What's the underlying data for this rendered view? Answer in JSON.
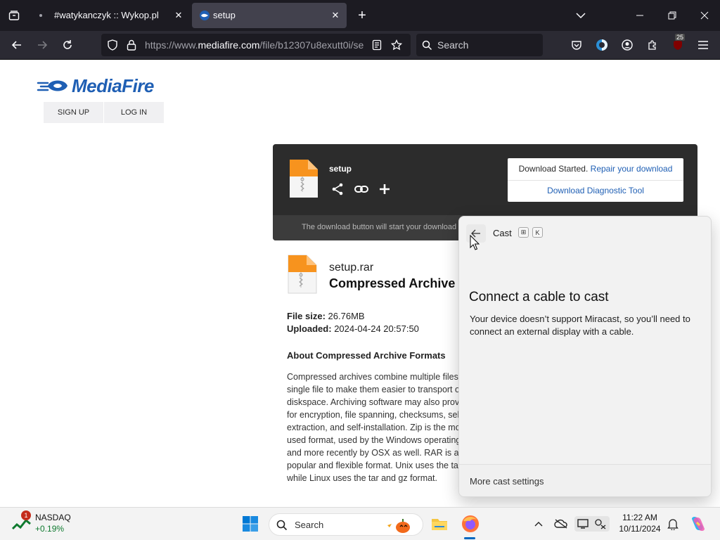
{
  "browser": {
    "tabs": [
      {
        "title": "#watykanczyk :: Wykop.pl",
        "active": false
      },
      {
        "title": "setup",
        "active": true
      }
    ],
    "url": {
      "prefix": "https://www.",
      "domain": "mediafire.com",
      "path": "/file/b12307u8exutt0i/se"
    },
    "search_placeholder": "Search",
    "extension_badge": "25"
  },
  "site": {
    "logo_text": "MediaFire",
    "sign_up": "SIGN UP",
    "log_in": "LOG IN"
  },
  "download": {
    "file_name": "setup",
    "status_prefix": "Download Started.",
    "repair_link": "Repair your download",
    "diagnostic_link": "Download Diagnostic Tool",
    "note": "The download button will start your download"
  },
  "file": {
    "name": "setup.rar",
    "type": "Compressed Archive",
    "size_label": "File size:",
    "size_value": "26.76MB",
    "uploaded_label": "Uploaded:",
    "uploaded_value": "2024-04-24 20:57:50",
    "about_heading": "About Compressed Archive Formats",
    "about_lines": [
      "Compressed archives combine multiple files into a",
      "single file to make them easier to transport or save on",
      "diskspace. Archiving software may also provide options",
      "for encryption, file spanning, checksums, self-",
      "extraction, and self-installation. Zip is the most-",
      "used format, used by the Windows operating system",
      "and more recently by OSX as well. RAR is also a",
      "popular and flexible format. Unix uses the tar",
      "while Linux uses the tar and gz format."
    ]
  },
  "cast": {
    "title": "Cast",
    "shortcut_keys": [
      "⊞",
      "K"
    ],
    "heading": "Connect a cable to cast",
    "description": "Your device doesn’t support Miracast, so you’ll need to connect an external display with a cable.",
    "more_settings": "More cast settings"
  },
  "taskbar": {
    "widget_name": "NASDAQ",
    "widget_change": "+0.19%",
    "widget_badge": "1",
    "search_placeholder": "Search",
    "time": "11:22 AM",
    "date": "10/11/2024"
  },
  "colors": {
    "mediafire_blue": "#1f5fb4",
    "browser_dark": "#1c1b22",
    "nasdaq_green": "#0f7a2f"
  }
}
